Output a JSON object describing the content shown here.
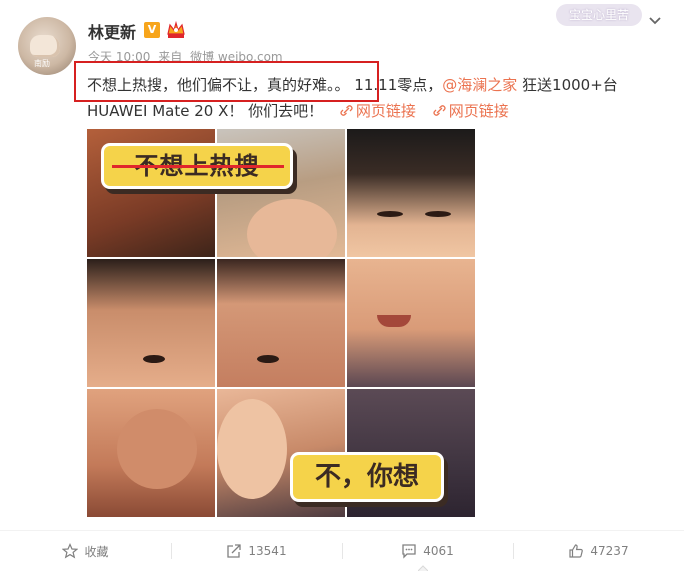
{
  "user": {
    "name": "林更新",
    "verified_badge": "V",
    "avatar_tag": "南励",
    "crown_icon": "crown-icon"
  },
  "meta": {
    "time": "今天 10:00",
    "source_prefix": "来自",
    "source": "微博 weibo.com"
  },
  "header": {
    "skin_label": "宝宝心里苦"
  },
  "post": {
    "highlighted": "不想上热搜，他们偏不让，真的好难。。",
    "part1": "11.11零点，",
    "mention": "@海澜之家",
    "part2": " 狂送1000+台",
    "line2": "HUAWEI Mate 20 X！ 你们去吧！",
    "link1": "网页链接",
    "link2": "网页链接"
  },
  "image": {
    "banner_top": "不想上热搜",
    "banner_bottom": "不，你想"
  },
  "actions": {
    "favorite": "收藏",
    "repost": "13541",
    "comment": "4061",
    "like": "47237"
  },
  "colors": {
    "link": "#eb7350",
    "highlight_box": "#d62020",
    "banner": "#f5d34a",
    "verified": "#f7a51b"
  }
}
